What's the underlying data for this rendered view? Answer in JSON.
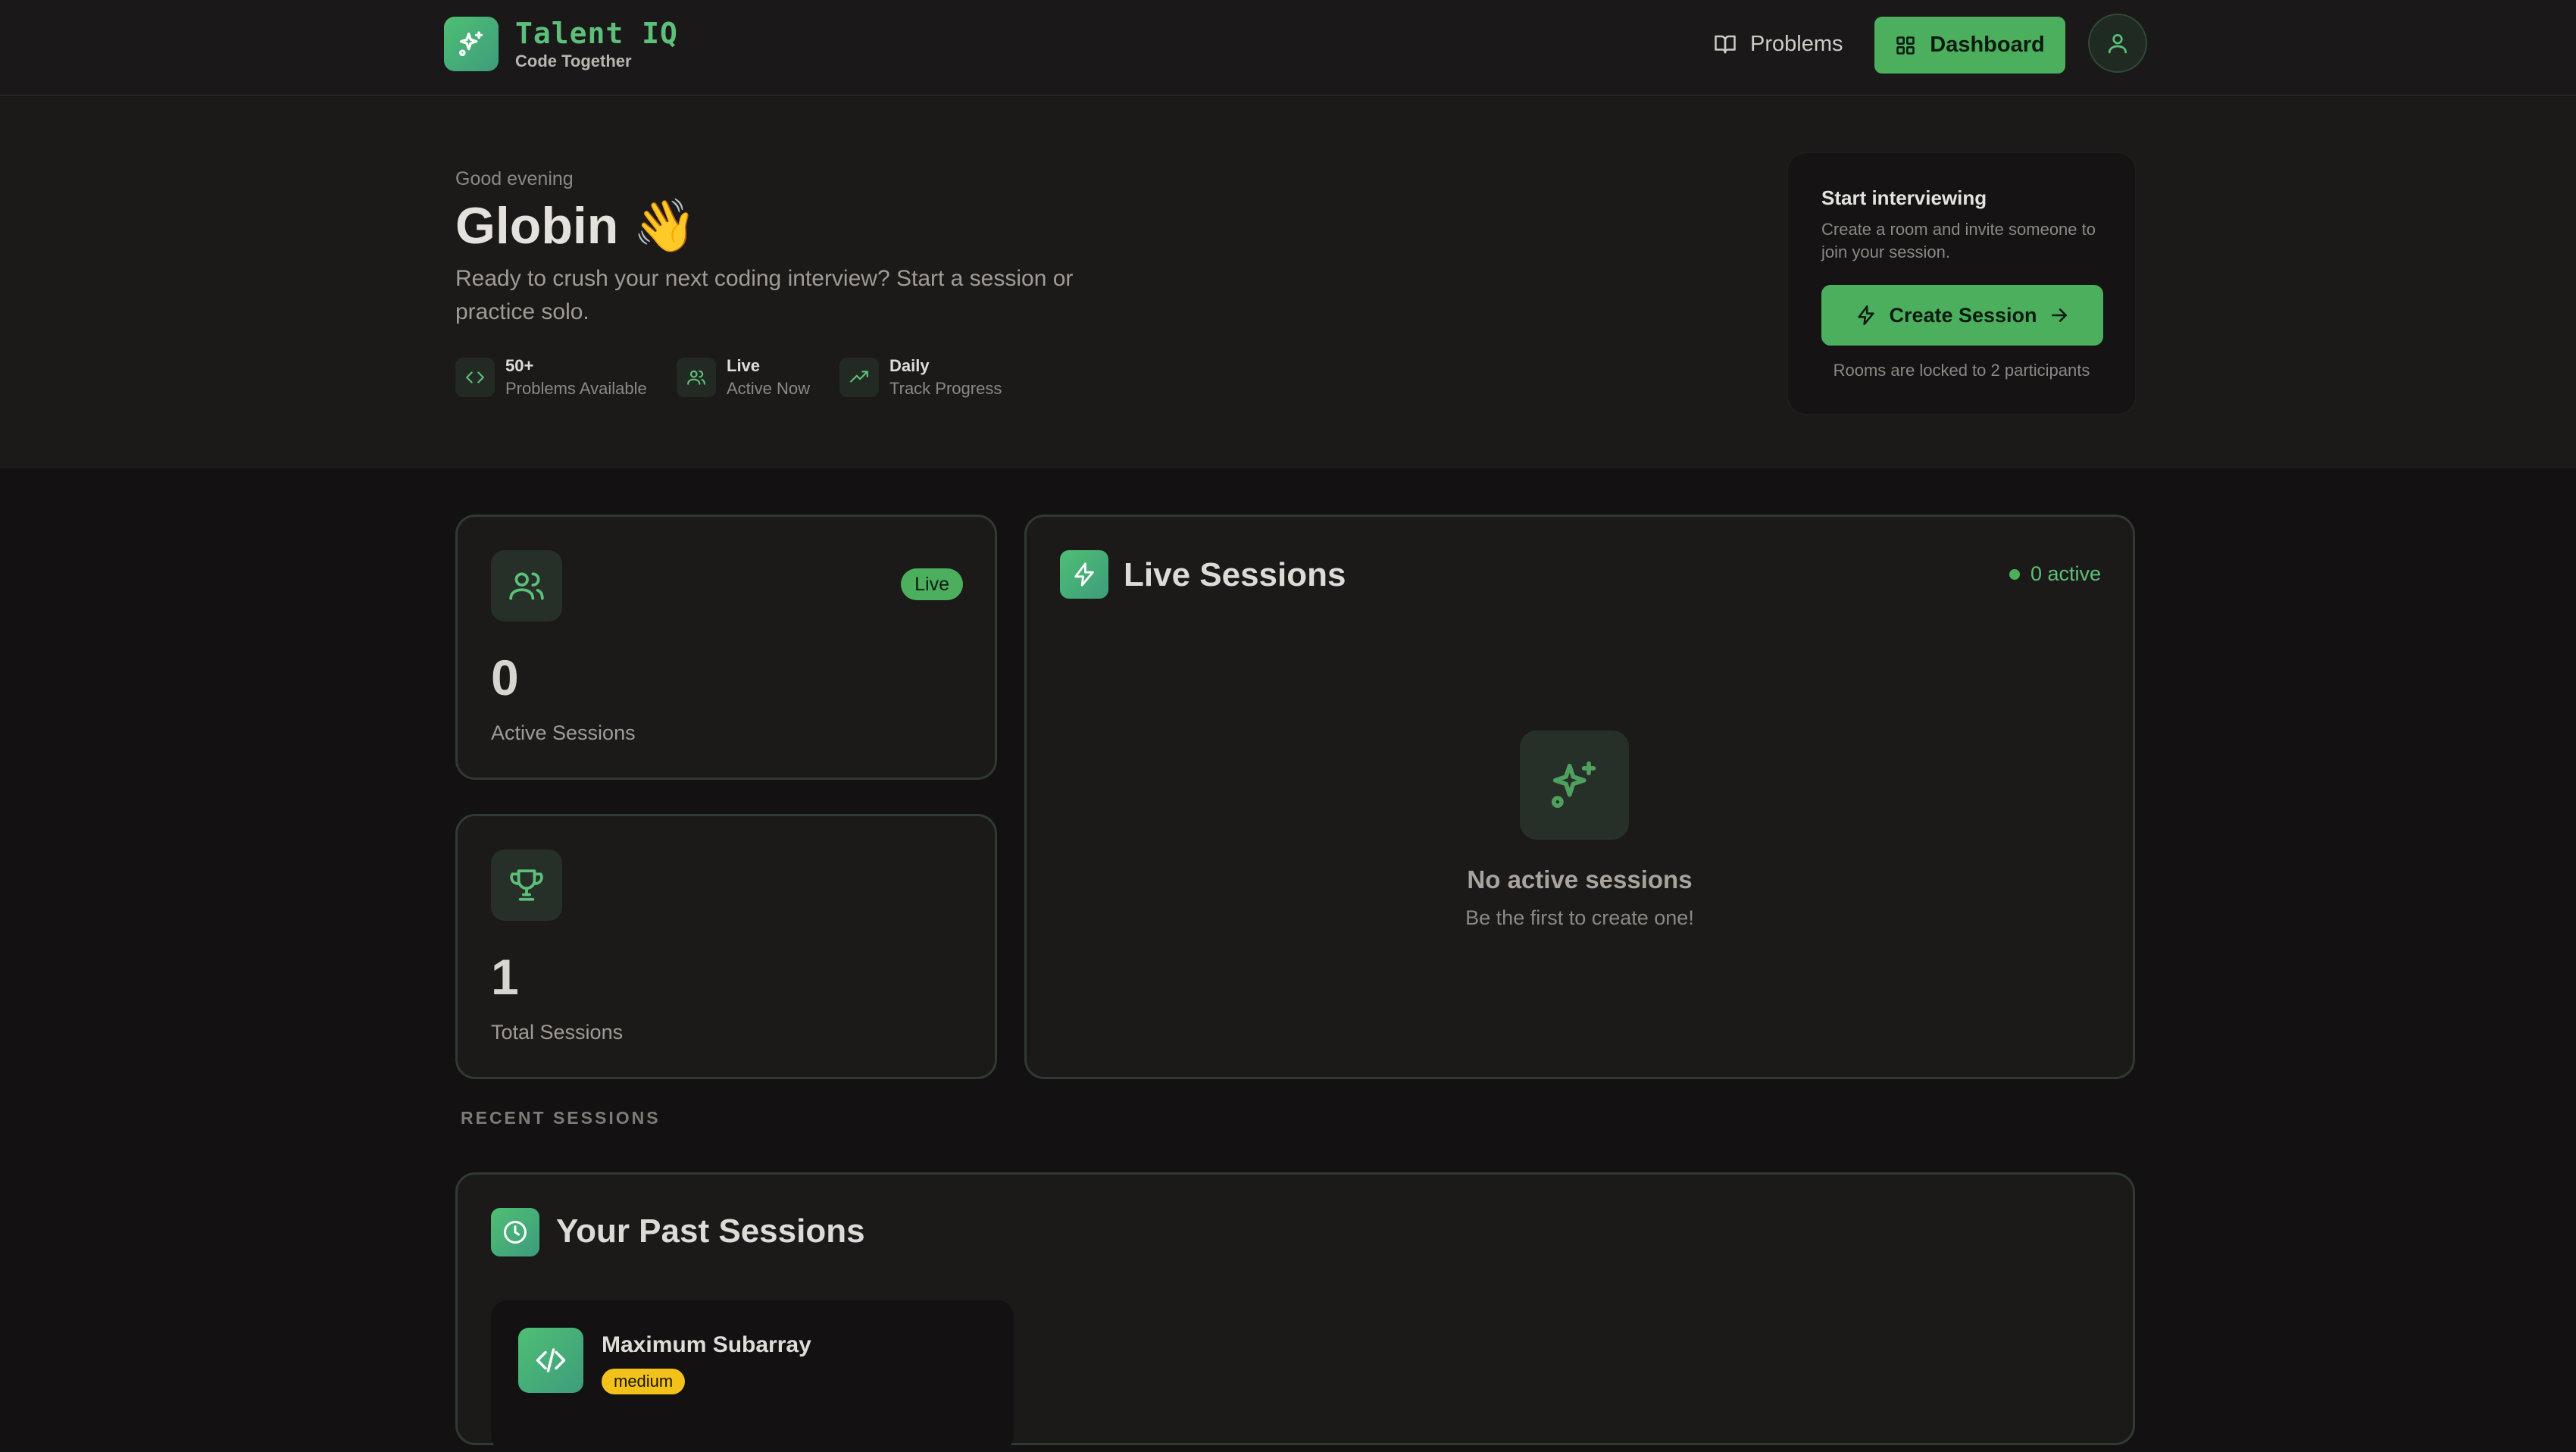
{
  "header": {
    "brand_name": "Talent IQ",
    "brand_tagline": "Code Together",
    "nav_problems": "Problems",
    "nav_dashboard": "Dashboard"
  },
  "hero": {
    "greeting": "Good evening",
    "name": "Globin 👋",
    "subtitle": "Ready to crush your next coding interview? Start a session or practice solo.",
    "chips": [
      {
        "title": "50+",
        "sub": "Problems Available"
      },
      {
        "title": "Live",
        "sub": "Active Now"
      },
      {
        "title": "Daily",
        "sub": "Track Progress"
      }
    ]
  },
  "start_card": {
    "title": "Start interviewing",
    "description": "Create a room and invite someone to join your session.",
    "button": "Create Session",
    "note": "Rooms are locked to 2 participants"
  },
  "stats": {
    "active": {
      "badge": "Live",
      "value": "0",
      "label": "Active Sessions"
    },
    "total": {
      "value": "1",
      "label": "Total Sessions"
    }
  },
  "live_sessions": {
    "title": "Live Sessions",
    "active_count": "0 active",
    "empty_title": "No active sessions",
    "empty_sub": "Be the first to create one!"
  },
  "recent": {
    "section_label": "RECENT SESSIONS",
    "title": "Your Past Sessions",
    "sessions": [
      {
        "title": "Maximum Subarray",
        "difficulty": "medium"
      }
    ]
  },
  "colors": {
    "accent": "#4caf5e",
    "background": "#131111",
    "medium_badge": "#f2c21a"
  }
}
